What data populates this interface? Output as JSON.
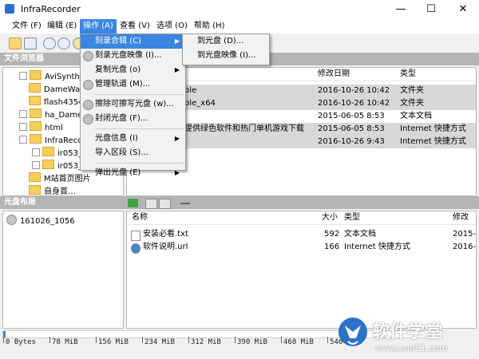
{
  "window": {
    "title": "InfraRecorder",
    "minimize_label": "—",
    "maximize_label": "☐",
    "close_label": "✕"
  },
  "menubar": [
    {
      "label": "文件 (F)"
    },
    {
      "label": "编辑 (E)"
    },
    {
      "label": "操作 (A)"
    },
    {
      "label": "查看 (V)"
    },
    {
      "label": "选项 (O)"
    },
    {
      "label": "帮助 (H)"
    }
  ],
  "file_browser": {
    "header": "文件浏览器",
    "tree": [
      {
        "label": "AviSynth_1",
        "expander": true
      },
      {
        "label": "DameWare",
        "expander": false
      },
      {
        "label": "flash4354",
        "expander": false
      },
      {
        "label": "ha_DameW",
        "expander": true
      },
      {
        "label": "html",
        "expander": true
      },
      {
        "label": "InfraRecor",
        "expander": true
      },
      {
        "label": "ir053_p",
        "expander": true
      },
      {
        "label": "ir053_p",
        "expander": true
      },
      {
        "label": "M站首页图片",
        "expander": false
      },
      {
        "label": "自身首…",
        "expander": false
      }
    ],
    "list_columns": {
      "modified": "修改日期",
      "type": "类型"
    },
    "list_rows": [
      {
        "name": "ble",
        "modified": "2016-10-26 10:42",
        "type": "文件夹"
      },
      {
        "name": "ble_x64",
        "modified": "2016-10-26 10:42",
        "type": "文件夹"
      },
      {
        "name": "",
        "modified": "2015-06-05 8:53",
        "type": "文本文档"
      },
      {
        "name": "提供绿色软件和热门单机游戏下载",
        "modified": "2015-06-05 8:53",
        "type": "Internet 快捷方式"
      },
      {
        "name": "",
        "modified": "2016-10-26 9:43",
        "type": "Internet 快捷方式"
      }
    ]
  },
  "disc_layout": {
    "header": "光盘布局",
    "tree_root": "161026_1056",
    "columns": {
      "name": "名称",
      "size": "大小",
      "type": "类型",
      "modified": "修改"
    },
    "rows": [
      {
        "name": "安装必看.txt",
        "size": "592",
        "type": "文本文档",
        "modified": "2015-"
      },
      {
        "name": "软件说明.url",
        "size": "166",
        "type": "Internet 快捷方式",
        "modified": "2016-"
      }
    ]
  },
  "action_menu": {
    "items": [
      {
        "label": "刻录合辑 (C)",
        "submenu": true,
        "highlighted": true,
        "icon": "none"
      },
      {
        "label": "刻录光盘映像 (I)...",
        "submenu": false,
        "icon": "disc-image-icon"
      },
      {
        "label": "复制光盘 (o)",
        "submenu": true,
        "icon": "none"
      },
      {
        "label": "管理轨道 (M)...",
        "submenu": false,
        "icon": "tracks-icon"
      },
      {
        "sep": true
      },
      {
        "label": "擦除可擦写光盘 (w)...",
        "submenu": false,
        "icon": "erase-icon"
      },
      {
        "label": "封闭光盘 (F)...",
        "submenu": false,
        "icon": "fixate-icon"
      },
      {
        "sep": true
      },
      {
        "label": "光盘信息 (I)",
        "submenu": true,
        "icon": "none"
      },
      {
        "label": "导入区段 (S)...",
        "submenu": false,
        "icon": "none"
      },
      {
        "sep": true
      },
      {
        "label": "弹出光盘 (E)",
        "submenu": true,
        "icon": "none"
      }
    ]
  },
  "submenu": {
    "items": [
      {
        "label": "到光盘 (D)..."
      },
      {
        "label": "到光盘映像 (I)..."
      }
    ]
  },
  "capacity_bar": {
    "fill_fraction": 0.005,
    "labels": [
      "0 Bytes",
      "78 MiB",
      "156 MiB",
      "234 MiB",
      "312 MiB",
      "390 MiB",
      "468 MiB",
      "546 MiB"
    ],
    "fill_color": "#3c8bd4"
  },
  "watermark": {
    "brand": "软件学堂",
    "url": "www.xue51.com"
  }
}
